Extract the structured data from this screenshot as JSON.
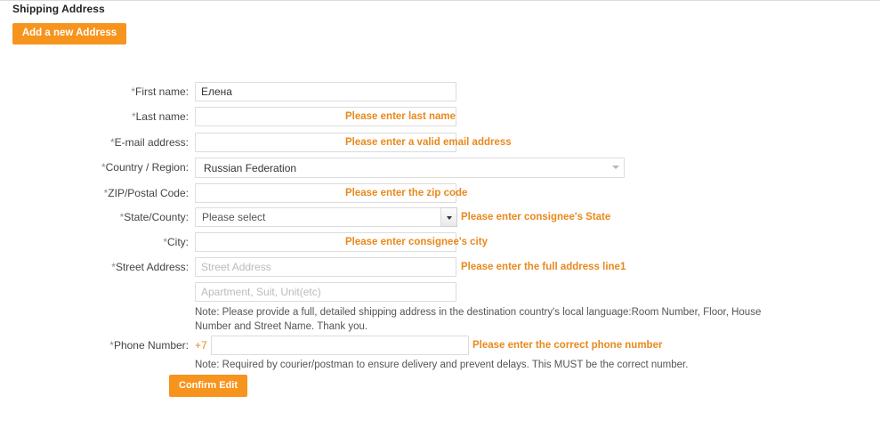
{
  "header": {
    "section_title": "Shipping Address",
    "add_address_label": "Add a new Address"
  },
  "form": {
    "fields": [
      {
        "id": "first-name",
        "label": "*First name:",
        "value": "Елена",
        "placeholder": "",
        "error": ""
      },
      {
        "id": "last-name",
        "label": "*Last name:",
        "value": "",
        "placeholder": "",
        "error": "Please enter last name"
      },
      {
        "id": "email-address",
        "label": "*E-mail address:",
        "value": "",
        "placeholder": "",
        "error": "Please enter a valid email address"
      },
      {
        "id": "country-region",
        "label": "*Country / Region:",
        "value": "Russian Federation",
        "placeholder": "",
        "error": ""
      },
      {
        "id": "zip-postal-code",
        "label": "*ZIP/Postal Code:",
        "value": "",
        "placeholder": "",
        "error": "Please enter the zip code"
      },
      {
        "id": "state-county",
        "label": "*State/County:",
        "value": "Please select",
        "placeholder": "",
        "error": "Please enter consignee's State"
      },
      {
        "id": "city",
        "label": "*City:",
        "value": "",
        "placeholder": "",
        "error": "Please enter consignee's city"
      },
      {
        "id": "street-address",
        "label": "*Street Address:",
        "value": "",
        "placeholder": "Street Address",
        "error": "Please enter the full address line1"
      },
      {
        "id": "apartment",
        "label": "",
        "value": "",
        "placeholder": "Apartment, Suit, Unit(etc)",
        "error": ""
      },
      {
        "id": "phone-number",
        "label": "*Phone Number:",
        "value": "",
        "placeholder": "",
        "error": "Please enter the correct phone number"
      }
    ],
    "phone_prefix": "+7",
    "address_note": "Note: Please provide a full, detailed shipping address in the destination country's local language:Room Number, Floor, House Number and Street Name. Thank you.",
    "phone_note": "Note: Required by courier/postman to ensure delivery and prevent delays. This MUST be the correct number.",
    "confirm_label": "Confirm Edit",
    "country_select_options": [
      "Russian Federation"
    ],
    "state_select_options": [
      "Please select"
    ]
  },
  "colors": {
    "accent_orange": "#f7941d",
    "error_orange": "#e8891c",
    "border_grey": "#dcdcdc",
    "text_dark": "#333333"
  },
  "icons": {
    "country_caret": "chevron-down-icon",
    "state_caret": "chevron-down-icon"
  }
}
